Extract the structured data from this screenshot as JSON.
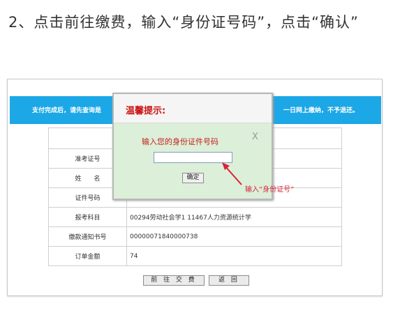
{
  "heading": {
    "text": "2、点击前往缴费，输入“身份证号码”，点击“确认”"
  },
  "banner": {
    "left_text": "支付完成后，请先查询是",
    "right_text": "一日网上缴纳，不予退还。",
    "color": "#1ca7e6"
  },
  "table": {
    "rows": [
      {
        "label": "准考证号",
        "value": ""
      },
      {
        "label": "姓　　名",
        "value": ""
      },
      {
        "label": "证件号码",
        "value": ""
      },
      {
        "label": "报考科目",
        "value": "00294劳动社会学1 11467人力资源统计学"
      },
      {
        "label": "缴款通知书号",
        "value": "00000071840000738"
      },
      {
        "label": "订单金额",
        "value": "74"
      }
    ]
  },
  "buttons": {
    "go_pay": "前 往 交 费",
    "back": "返 回"
  },
  "dialog": {
    "title": "温馨提示:",
    "prompt": "输入您的身份证件号码",
    "close": "X",
    "input_value": "",
    "confirm": "确定",
    "background": "#dcefd8"
  },
  "annotation": {
    "text": "输入“身份证号”",
    "color": "#d7233a"
  }
}
